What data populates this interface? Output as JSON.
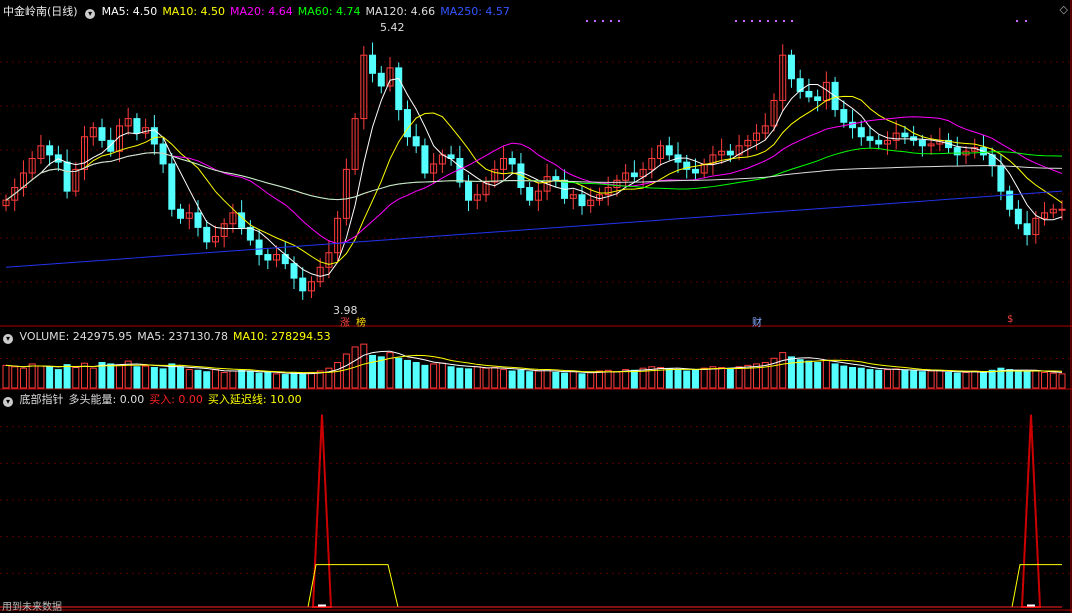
{
  "header": {
    "title": "中金岭南(日线)",
    "ma_items": [
      {
        "label": "MA5: 4.50",
        "color": "#ffffff"
      },
      {
        "label": "MA10: 4.50",
        "color": "#ffff00"
      },
      {
        "label": "MA20: 4.64",
        "color": "#ff00ff"
      },
      {
        "label": "MA60: 4.74",
        "color": "#00ff00"
      },
      {
        "label": "MA120: 4.66",
        "color": "#dddddd"
      },
      {
        "label": "MA250: 4.57",
        "color": "#3355ff"
      }
    ]
  },
  "volume_header": {
    "items": [
      {
        "label": "VOLUME: 242975.95",
        "color": "#dddddd"
      },
      {
        "label": "MA5: 237130.78",
        "color": "#dddddd"
      },
      {
        "label": "MA10: 278294.53",
        "color": "#ffff00"
      }
    ]
  },
  "indicator_header": {
    "items": [
      {
        "label": "底部指针",
        "color": "#dddddd"
      },
      {
        "label": "多头能量: 0.00",
        "color": "#dddddd"
      },
      {
        "label": "买入: 0.00",
        "color": "#ff2222"
      },
      {
        "label": "买入延迟线: 10.00",
        "color": "#ffff00"
      }
    ]
  },
  "annotations": {
    "high_label": "5.42",
    "low_label": "3.98",
    "tag_zhang": "涨",
    "tag_bang": "榜",
    "tag_cai": "财",
    "tag_s": "$"
  },
  "footer": {
    "note": "用到未来数据"
  },
  "colors": {
    "up": "#ff3c3c",
    "down": "#54ffff",
    "ma5": "#ffffff",
    "ma10": "#ffff00",
    "ma20": "#ff00ff",
    "ma60": "#00ff00",
    "ma120": "#dddddd",
    "ma250": "#2233ee",
    "panel_border": "#b00000"
  },
  "chart_data": [
    {
      "type": "candlestick",
      "ylim": [
        3.9,
        5.5
      ],
      "high": 5.42,
      "low": 3.98,
      "closes": [
        4.55,
        4.62,
        4.7,
        4.78,
        4.85,
        4.8,
        4.76,
        4.6,
        4.72,
        4.9,
        4.95,
        4.88,
        4.82,
        4.96,
        5.0,
        4.92,
        4.95,
        4.86,
        4.75,
        4.5,
        4.45,
        4.48,
        4.4,
        4.32,
        4.35,
        4.42,
        4.48,
        4.4,
        4.33,
        4.25,
        4.22,
        4.25,
        4.2,
        4.12,
        4.05,
        4.1,
        4.18,
        4.26,
        4.45,
        4.72,
        5.0,
        5.35,
        5.25,
        5.18,
        5.28,
        5.05,
        4.9,
        4.85,
        4.7,
        4.75,
        4.8,
        4.78,
        4.65,
        4.55,
        4.58,
        4.65,
        4.72,
        4.78,
        4.75,
        4.62,
        4.55,
        4.6,
        4.68,
        4.66,
        4.56,
        4.58,
        4.52,
        4.55,
        4.58,
        4.62,
        4.66,
        4.7,
        4.68,
        4.72,
        4.78,
        4.85,
        4.8,
        4.76,
        4.72,
        4.7,
        4.75,
        4.8,
        4.82,
        4.8,
        4.85,
        4.88,
        4.92,
        4.96,
        5.1,
        5.35,
        5.22,
        5.15,
        5.12,
        5.1,
        5.2,
        5.05,
        4.98,
        4.95,
        4.9,
        4.88,
        4.86,
        4.88,
        4.92,
        4.9,
        4.88,
        4.85,
        4.86,
        4.88,
        4.84,
        4.8,
        4.82,
        4.84,
        4.8,
        4.74,
        4.6,
        4.5,
        4.42,
        4.36,
        4.45,
        4.48,
        4.5,
        4.5
      ]
    },
    {
      "type": "bar",
      "series_name": "VOLUME",
      "last_value": 242975.95,
      "values": [
        3.2,
        3.0,
        2.8,
        3.4,
        3.1,
        3.0,
        2.6,
        3.3,
        2.9,
        3.5,
        2.8,
        3.6,
        3.4,
        3.2,
        3.8,
        3.0,
        3.1,
        2.9,
        2.7,
        3.4,
        3.0,
        2.6,
        2.5,
        2.3,
        2.6,
        2.2,
        2.4,
        2.5,
        2.3,
        2.1,
        2.2,
        2.0,
        1.9,
        2.1,
        2.0,
        2.2,
        2.4,
        2.8,
        3.6,
        4.8,
        5.8,
        6.2,
        4.6,
        4.4,
        5.0,
        4.2,
        3.9,
        3.6,
        3.2,
        3.4,
        3.5,
        3.0,
        2.8,
        2.7,
        3.0,
        2.8,
        2.9,
        2.6,
        2.4,
        2.5,
        2.3,
        2.4,
        2.6,
        2.2,
        2.1,
        2.3,
        2.0,
        2.2,
        2.4,
        2.5,
        2.3,
        2.6,
        2.5,
        2.8,
        3.0,
        2.9,
        2.7,
        2.6,
        2.4,
        2.6,
        2.8,
        3.0,
        2.9,
        2.7,
        3.0,
        3.2,
        3.4,
        3.6,
        4.2,
        5.0,
        4.4,
        4.0,
        3.8,
        3.6,
        3.9,
        3.4,
        3.1,
        2.9,
        2.8,
        2.6,
        2.5,
        2.6,
        2.7,
        2.5,
        2.4,
        2.3,
        2.4,
        2.5,
        2.2,
        2.1,
        2.2,
        2.4,
        2.3,
        2.5,
        2.8,
        2.6,
        2.4,
        2.3,
        2.4,
        2.2,
        2.1,
        2.0
      ]
    },
    {
      "type": "line",
      "series": [
        {
          "name": "买入",
          "values": [
            {
              "i": 40,
              "v": 100
            },
            {
              "i": 120,
              "v": 100
            }
          ]
        },
        {
          "name": "买入延迟线",
          "values": [
            {
              "i": 40,
              "v": 22
            },
            {
              "i": 120,
              "v": 22
            }
          ]
        }
      ],
      "ylim": [
        0,
        105
      ]
    }
  ]
}
